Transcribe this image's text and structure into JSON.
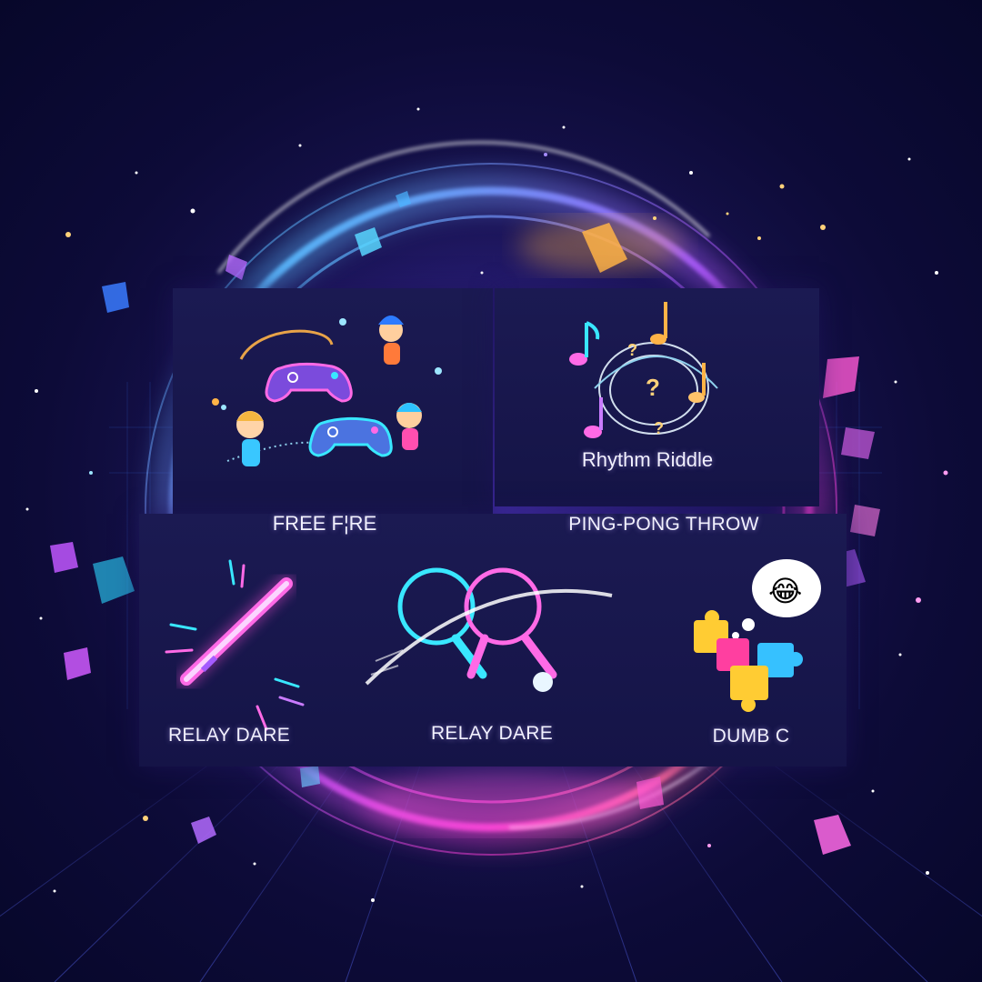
{
  "colors": {
    "cyan": "#39e7ff",
    "magenta": "#ff3fd8",
    "violet": "#a45cff",
    "orange": "#ffa63a",
    "panel": "#18174c",
    "background": "#0d0b38"
  },
  "tiles": [
    {
      "label": "FREE F¦RE",
      "icons": [
        "gamepad-icon",
        "gamepad-icon",
        "cartoon-kid-icon",
        "cartoon-kid-icon",
        "cartoon-kid-icon",
        "sparkle-trail-icon"
      ]
    },
    {
      "label": "Rhythm Riddle",
      "icons": [
        "music-note-icon",
        "music-note-icon",
        "question-mark-icon",
        "swirl-icon"
      ]
    },
    {
      "label": "PING-PONG THROW",
      "icons": []
    },
    {
      "label": "RELAY DARE",
      "icons": [
        "neon-baton-icon",
        "burst-icon"
      ]
    },
    {
      "label": "RELAY DARE",
      "icons": [
        "ping-pong-paddle-icon",
        "ping-pong-paddle-icon",
        "ping-pong-ball-icon"
      ]
    },
    {
      "label": "DUMB C",
      "icons": [
        "puzzle-piece-icon",
        "laughing-emoji-icon",
        "thought-bubble-icon"
      ]
    }
  ],
  "emoji": {
    "laughing": "😂"
  }
}
